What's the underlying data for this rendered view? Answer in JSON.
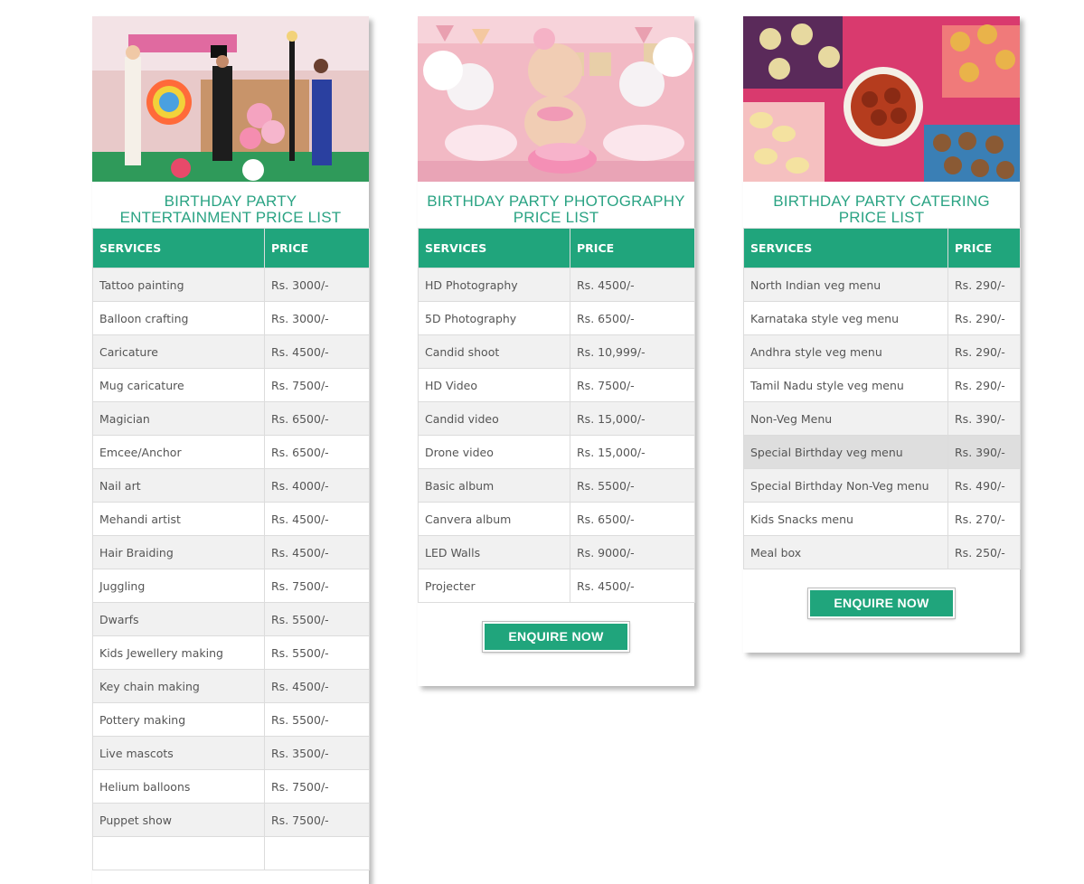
{
  "cards": {
    "entertainment": {
      "title": "BIRTHDAY PARTY ENTERTAINMENT PRICE LIST",
      "header_services": "SERVICES",
      "header_price": "PRICE",
      "rows": [
        {
          "service": "Tattoo painting",
          "price": "Rs. 3000/-"
        },
        {
          "service": "Balloon crafting",
          "price": "Rs. 3000/-"
        },
        {
          "service": "Caricature",
          "price": "Rs. 4500/-"
        },
        {
          "service": "Mug caricature",
          "price": "Rs. 7500/-"
        },
        {
          "service": "Magician",
          "price": "Rs. 6500/-"
        },
        {
          "service": "Emcee/Anchor",
          "price": "Rs. 6500/-"
        },
        {
          "service": "Nail art",
          "price": "Rs. 4000/-"
        },
        {
          "service": "Mehandi artist",
          "price": "Rs. 4500/-"
        },
        {
          "service": "Hair Braiding",
          "price": "Rs. 4500/-"
        },
        {
          "service": "Juggling",
          "price": "Rs. 7500/-"
        },
        {
          "service": "Dwarfs",
          "price": "Rs. 5500/-"
        },
        {
          "service": "Kids Jewellery making",
          "price": "Rs. 5500/-"
        },
        {
          "service": "Key chain making",
          "price": "Rs. 4500/-"
        },
        {
          "service": "Pottery making",
          "price": "Rs. 5500/-"
        },
        {
          "service": "Live mascots",
          "price": "Rs. 3500/-"
        },
        {
          "service": "Helium balloons",
          "price": "Rs. 7500/-"
        },
        {
          "service": "Puppet show",
          "price": "Rs. 7500/-"
        }
      ]
    },
    "photography": {
      "title": "BIRTHDAY PARTY PHOTOGRAPHY PRICE LIST",
      "header_services": "SERVICES",
      "header_price": "PRICE",
      "rows": [
        {
          "service": "HD Photography",
          "price": "Rs. 4500/-"
        },
        {
          "service": "5D Photography",
          "price": "Rs. 6500/-"
        },
        {
          "service": "Candid shoot",
          "price": "Rs. 10,999/-"
        },
        {
          "service": "HD Video",
          "price": "Rs. 7500/-"
        },
        {
          "service": "Candid video",
          "price": "Rs. 15,000/-"
        },
        {
          "service": "Drone video",
          "price": "Rs. 15,000/-"
        },
        {
          "service": "Basic album",
          "price": "Rs. 5500/-"
        },
        {
          "service": "Canvera album",
          "price": "Rs. 6500/-"
        },
        {
          "service": "LED Walls",
          "price": "Rs. 9000/-"
        },
        {
          "service": "Projecter",
          "price": "Rs. 4500/-"
        }
      ],
      "button_label": "ENQUIRE NOW"
    },
    "catering": {
      "title": "BIRTHDAY PARTY CATERING PRICE LIST",
      "header_services": "SERVICES",
      "header_price": "PRICE",
      "rows": [
        {
          "service": "North Indian veg menu",
          "price": "Rs. 290/-"
        },
        {
          "service": "Karnataka style veg menu",
          "price": "Rs. 290/-"
        },
        {
          "service": "Andhra style veg menu",
          "price": "Rs. 290/-"
        },
        {
          "service": "Tamil Nadu style veg menu",
          "price": "Rs. 290/-"
        },
        {
          "service": "Non-Veg Menu",
          "price": "Rs. 390/-"
        },
        {
          "service": "Special Birthday veg menu",
          "price": "Rs. 390/-"
        },
        {
          "service": "Special Birthday Non-Veg menu",
          "price": "Rs. 490/-"
        },
        {
          "service": "Kids Snacks menu",
          "price": "Rs. 270/-"
        },
        {
          "service": "Meal box",
          "price": "Rs. 250/-"
        }
      ],
      "button_label": "ENQUIRE NOW"
    }
  },
  "colors": {
    "accent": "#20a57c",
    "title_text": "#2aa383",
    "row_alt": "#f1f1f1",
    "row_highlight": "#dedede",
    "cell_text": "#555555"
  }
}
